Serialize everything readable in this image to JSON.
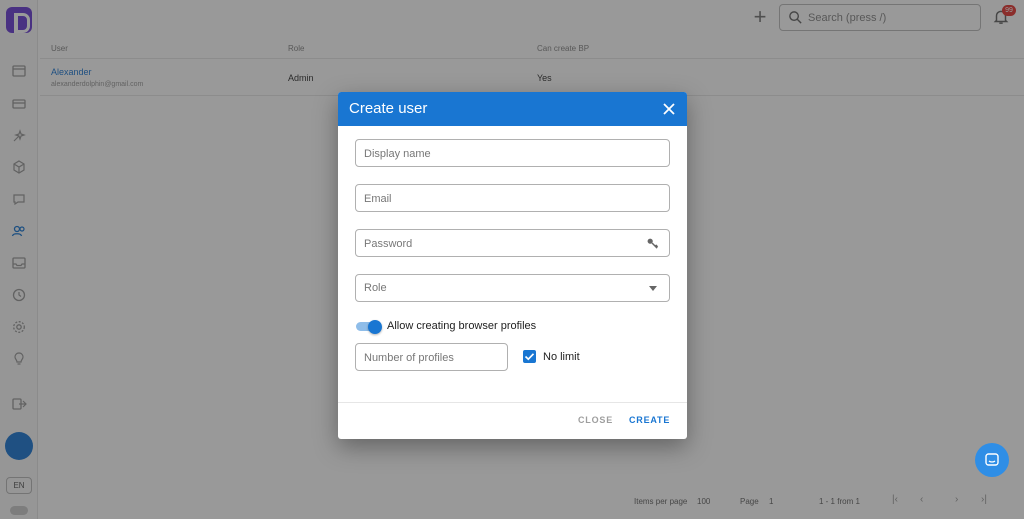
{
  "topbar": {
    "search_placeholder": "Search (press /)",
    "notification_count": "99"
  },
  "table": {
    "headers": [
      "User",
      "Role",
      "Can create BP"
    ],
    "rows": [
      {
        "name": "Alexander",
        "email": "alexanderdolphin@gmail.com",
        "role": "Admin",
        "can_create_bp": "Yes"
      }
    ]
  },
  "pagination": {
    "items_per_page_label": "Items per page",
    "items_per_page_value": "100",
    "page_label": "Page",
    "page_value": "1",
    "range_text": "1 - 1 from 1"
  },
  "sidebar": {
    "language": "EN"
  },
  "dialog": {
    "title": "Create user",
    "display_name_placeholder": "Display name",
    "email_placeholder": "Email",
    "password_placeholder": "Password",
    "role_label": "Role",
    "allow_profiles_label": "Allow creating browser profiles",
    "allow_profiles_on": true,
    "profiles_count_placeholder": "Number of profiles",
    "no_limit_label": "No limit",
    "no_limit_checked": true,
    "close_button": "CLOSE",
    "create_button": "CREATE"
  },
  "colors": {
    "accent": "#1976d2",
    "overlay": "rgba(33,33,33,0.46)"
  }
}
